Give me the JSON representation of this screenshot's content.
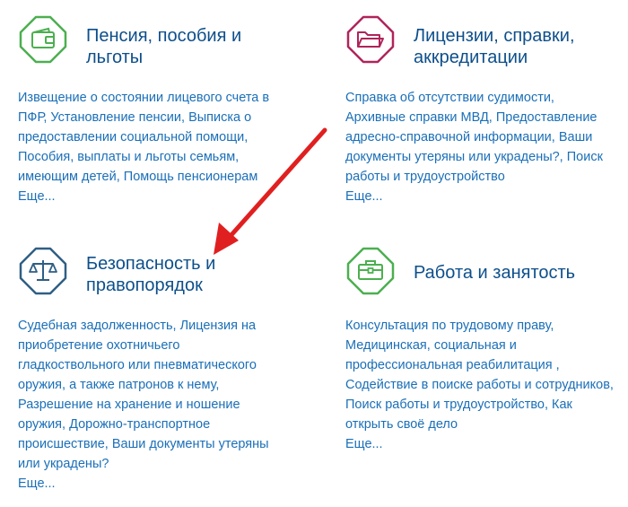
{
  "colors": {
    "green": "#4caf50",
    "magenta": "#b0245a",
    "navy": "#2f5f85",
    "red_arrow": "#e02020"
  },
  "cards": [
    {
      "title_line1": "Пенсия, пособия и",
      "title_line2": "льготы",
      "icon": "wallet-icon",
      "lines": [
        "Извещение о состоянии лицевого счета в",
        "ПФР, Установление пенсии, Выписка о",
        "предоставлении социальной помощи,",
        "Пособия, выплаты и льготы семьям,",
        "имеющим детей, Помощь пенсионерам"
      ],
      "more": "Еще..."
    },
    {
      "title_line1": "Лицензии, справки,",
      "title_line2": "аккредитации",
      "icon": "folder-icon",
      "lines": [
        "Справка об отсутствии судимости,",
        "Архивные справки МВД, Предоставление",
        "адресно-справочной информации, Ваши",
        "документы утеряны или украдены?, Поиск",
        "работы и трудоустройство"
      ],
      "more": "Еще..."
    },
    {
      "title_line1": "Безопасность и",
      "title_line2": "правопорядок",
      "icon": "scales-icon",
      "lines": [
        "Судебная задолженность, Лицензия на",
        "приобретение охотничьего",
        "гладкоствольного или пневматического",
        "оружия, а также патронов к нему,",
        "Разрешение на хранение и ношение",
        "оружия, Дорожно-транспортное",
        "происшествие, Ваши документы утеряны",
        "или украдены?"
      ],
      "more": "Еще..."
    },
    {
      "title_line1": "Работа и занятость",
      "title_line2": "",
      "icon": "briefcase-icon",
      "lines": [
        "Консультация по трудовому праву,",
        "Медицинская, социальная и",
        "профессиональная реабилитация ,",
        "Содействие в поиске работы и сотрудников,",
        "Поиск работы и трудоустройство, Как",
        "открыть своё дело"
      ],
      "more": "Еще..."
    }
  ]
}
